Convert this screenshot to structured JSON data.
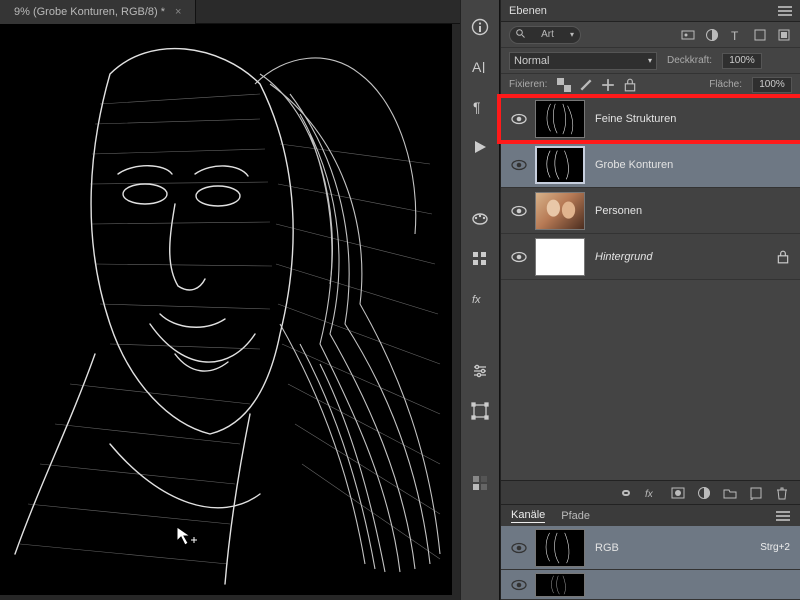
{
  "doc_tab": {
    "title": "9% (Grobe Konturen, RGB/8) *"
  },
  "layers_panel": {
    "title": "Ebenen",
    "search_label": "Art",
    "blend_mode": "Normal",
    "opacity_label": "Deckkraft:",
    "opacity_value": "100%",
    "lock_label": "Fixieren:",
    "fill_label": "Fläche:",
    "fill_value": "100%",
    "layers": [
      {
        "name": "Feine Strukturen",
        "highlight": true,
        "thumb": "edge",
        "italic": false
      },
      {
        "name": "Grobe Konturen",
        "selected": true,
        "thumb": "edge",
        "italic": false
      },
      {
        "name": "Personen",
        "thumb": "photo",
        "italic": false
      },
      {
        "name": "Hintergrund",
        "thumb": "white",
        "italic": true,
        "locked": true
      }
    ]
  },
  "channels_panel": {
    "tabs": [
      "Kanäle",
      "Pfade"
    ],
    "active_tab": 0,
    "rows": [
      {
        "name": "RGB",
        "shortcut": "Strg+2"
      },
      {
        "name": ""
      }
    ]
  }
}
